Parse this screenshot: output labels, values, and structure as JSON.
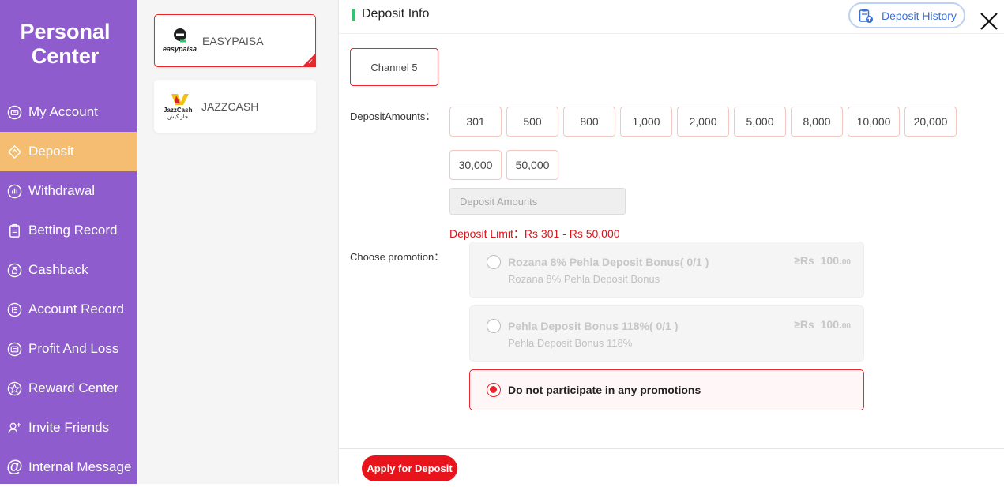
{
  "sidebar": {
    "title_line1": "Personal",
    "title_line2": "Center",
    "items": [
      {
        "label": "My Account",
        "icon": "account-icon"
      },
      {
        "label": "Deposit",
        "icon": "deposit-icon"
      },
      {
        "label": "Withdrawal",
        "icon": "withdrawal-icon"
      },
      {
        "label": "Betting Record",
        "icon": "clipboard-icon"
      },
      {
        "label": "Cashback",
        "icon": "money-bag-icon"
      },
      {
        "label": "Account Record",
        "icon": "list-icon"
      },
      {
        "label": "Profit And Loss",
        "icon": "profit-icon"
      },
      {
        "label": "Reward Center",
        "icon": "star-icon"
      },
      {
        "label": "Invite Friends",
        "icon": "invite-user-icon"
      },
      {
        "label": "Internal Message",
        "icon": "at-icon"
      }
    ],
    "active_index": 1
  },
  "channels": [
    {
      "name": "EASYPAISA",
      "logo_text": "easypaisa",
      "selected": true
    },
    {
      "name": "JAZZCASH",
      "logo_text": "JazzCash",
      "logo_subtext": "جاز کیش",
      "selected": false
    }
  ],
  "header": {
    "title": "Deposit Info",
    "history_label": "Deposit History"
  },
  "channel_tab": "Channel 5",
  "deposit": {
    "amounts_label": "DepositAmounts：",
    "amounts": [
      "301",
      "500",
      "800",
      "1,000",
      "2,000",
      "5,000",
      "8,000",
      "10,000",
      "20,000",
      "30,000",
      "50,000"
    ],
    "input_placeholder": "Deposit Amounts",
    "limit_text": "Deposit Limit：Rs  301  - Rs  50,000"
  },
  "promotion": {
    "label": "Choose promotion：",
    "options": [
      {
        "title": "Rozana 8% Pehla Deposit Bonus( 0/1 )",
        "subtitle": "Rozana 8% Pehla Deposit Bonus",
        "amount_prefix": "≥Rs",
        "amount": "100.",
        "amount_decimal": "00"
      },
      {
        "title": "Pehla Deposit Bonus 118%( 0/1 )",
        "subtitle": "Pehla Deposit Bonus 118%",
        "amount_prefix": "≥Rs",
        "amount": "100.",
        "amount_decimal": "00"
      }
    ],
    "none_label": "Do not participate in any promotions"
  },
  "apply_label": "Apply for Deposit",
  "colors": {
    "sidebar": "#8e5ccc",
    "active_nav": "#f4bd72",
    "accent_red": "#e8262c",
    "header_bar": "#2fc76b",
    "history_blue": "#3b6fd8"
  }
}
